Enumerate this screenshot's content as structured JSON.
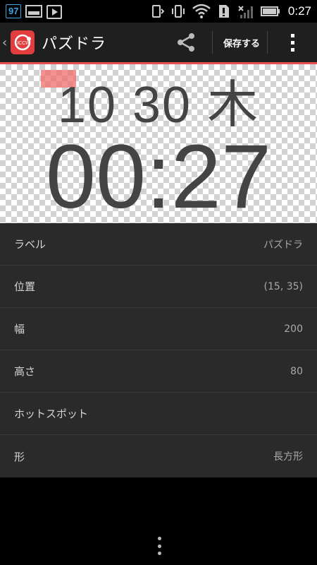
{
  "status_bar": {
    "notification_badge": "97",
    "time": "0:27"
  },
  "action_bar": {
    "title": "パズドラ",
    "save_label": "保存する",
    "logo_text": "UCCW"
  },
  "preview": {
    "date_line": "10 30 木",
    "time_line": "00:27"
  },
  "properties": [
    {
      "label": "ラベル",
      "value": "パズドラ"
    },
    {
      "label": "位置",
      "value": "(15, 35)"
    },
    {
      "label": "幅",
      "value": "200"
    },
    {
      "label": "高さ",
      "value": "80"
    },
    {
      "label": "ホットスポット",
      "value": ""
    },
    {
      "label": "形",
      "value": "長方形"
    }
  ],
  "colors": {
    "accent": "#e65050",
    "logo_bg": "#e43d3d",
    "panel_bg": "#2a2a2a"
  }
}
